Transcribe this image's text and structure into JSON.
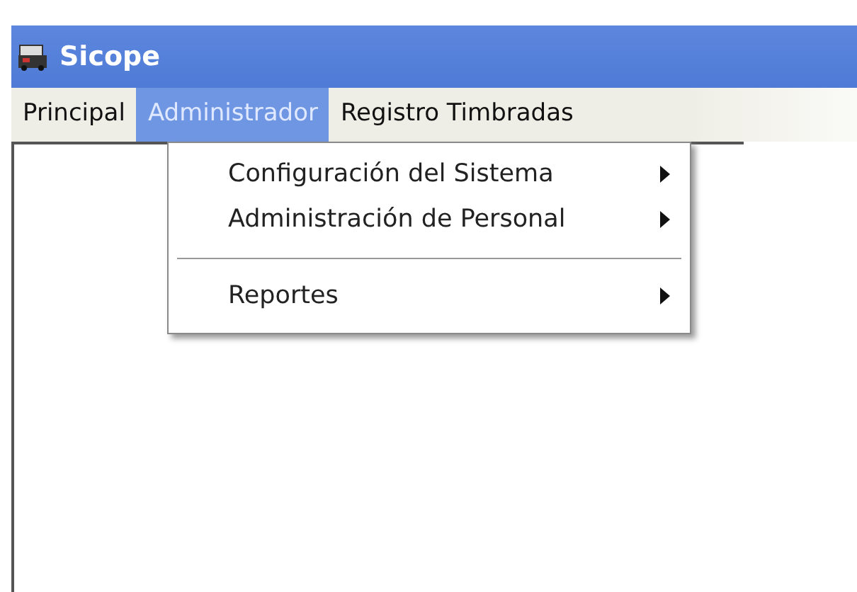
{
  "window": {
    "title": "Sicope"
  },
  "menu_bar": [
    {
      "label": "Principal",
      "selected": false
    },
    {
      "label": "Administrador",
      "selected": true
    },
    {
      "label": "Registro Timbradas",
      "selected": false
    }
  ],
  "dropdown": [
    {
      "kind": "item",
      "label": "Configuración del Sistema",
      "submenu": true
    },
    {
      "kind": "item",
      "label": "Administración de Personal",
      "submenu": true
    },
    {
      "kind": "separator"
    },
    {
      "kind": "item",
      "label": "Reportes",
      "submenu": true
    }
  ]
}
